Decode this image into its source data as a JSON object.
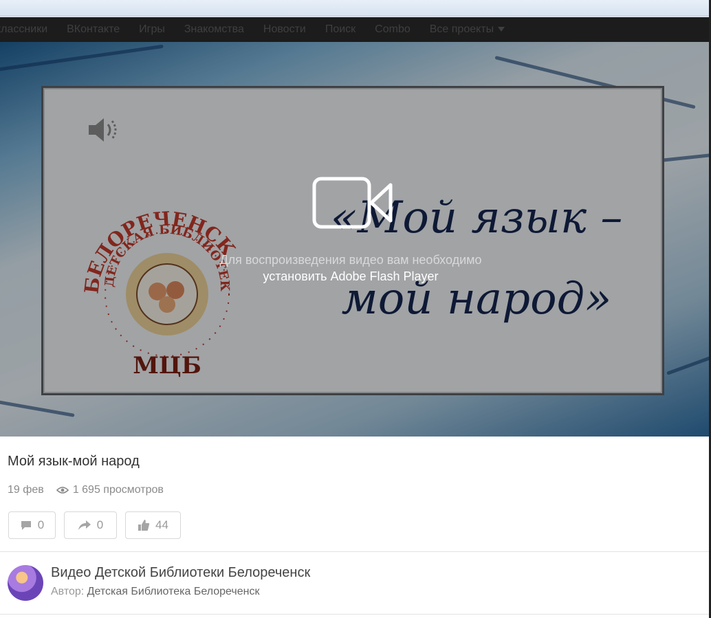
{
  "nav": {
    "items": [
      "классники",
      "ВКонтакте",
      "Игры",
      "Знакомства",
      "Новости",
      "Поиск",
      "Combo",
      "Все проекты"
    ]
  },
  "slide": {
    "title_line1": "«Мой язык –",
    "title_line2": "мой народ»",
    "logo_arc_outer": "БЕЛОРЕЧЕНСК",
    "logo_arc_inner": "ДЕТСКАЯ БИБЛИОТЕКА",
    "logo_abbr": "МЦБ"
  },
  "player": {
    "message": "Для воспроизведения видео вам необходимо",
    "link": "установить Adobe Flash Player"
  },
  "video": {
    "title": "Мой язык-мой народ",
    "date": "19 фев",
    "views": "1 695 просмотров"
  },
  "actions": {
    "comments": "0",
    "shares": "0",
    "likes": "44"
  },
  "channel": {
    "name": "Видео Детской Библиотеки Белореченск",
    "author_label": "Автор:",
    "author_name": "Детская Библиотека Белореченск"
  },
  "colors": {
    "nav_bg": "#1c1c1c",
    "slide_text": "#15264e",
    "logo_red": "#c0392b"
  }
}
